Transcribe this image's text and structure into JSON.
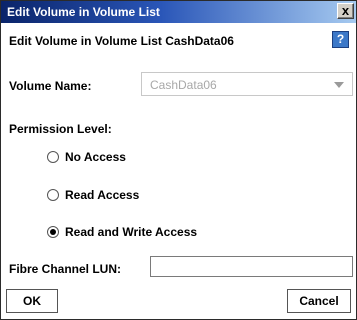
{
  "window": {
    "title": "Edit Volume in Volume List",
    "close_glyph": "x"
  },
  "heading": "Edit Volume in Volume List CashData06",
  "help": {
    "glyph": "?",
    "icon": "help-icon"
  },
  "volume": {
    "label": "Volume Name:",
    "value": "CashData06"
  },
  "permission": {
    "label": "Permission Level:",
    "options": [
      {
        "label": "No Access",
        "selected": false
      },
      {
        "label": "Read Access",
        "selected": false
      },
      {
        "label": "Read and Write Access",
        "selected": true
      }
    ]
  },
  "fibre": {
    "label": "Fibre Channel LUN:",
    "value": ""
  },
  "buttons": {
    "ok": "OK",
    "cancel": "Cancel"
  },
  "colors": {
    "titlebar_start": "#0a246a",
    "titlebar_end": "#a6caf0",
    "help_bg": "#3c78c8"
  }
}
